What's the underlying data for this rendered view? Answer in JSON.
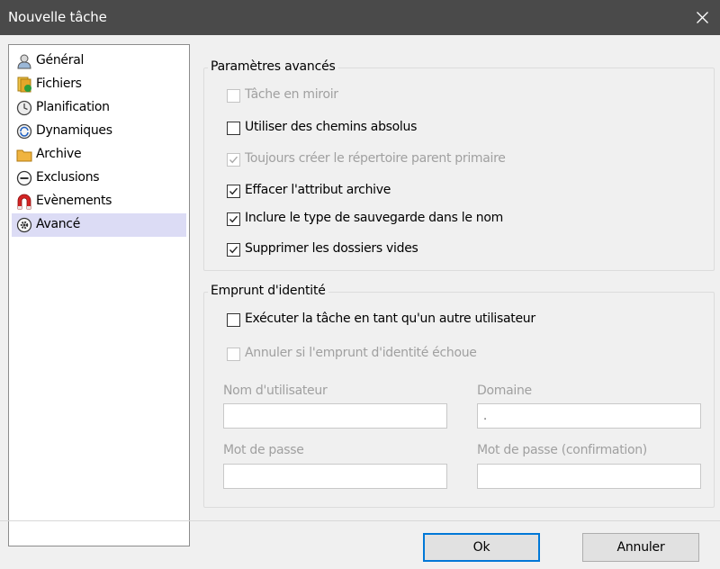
{
  "window": {
    "title": "Nouvelle tâche"
  },
  "nav": {
    "items": [
      {
        "label": "Général",
        "icon": "user-icon"
      },
      {
        "label": "Fichiers",
        "icon": "files-icon"
      },
      {
        "label": "Planification",
        "icon": "clock-icon"
      },
      {
        "label": "Dynamiques",
        "icon": "dynamics-icon"
      },
      {
        "label": "Archive",
        "icon": "archive-icon"
      },
      {
        "label": "Exclusions",
        "icon": "exclusions-icon"
      },
      {
        "label": "Evènements",
        "icon": "magnet-icon"
      },
      {
        "label": "Avancé",
        "icon": "gear-icon",
        "selected": true
      }
    ]
  },
  "advanced": {
    "title": "Paramètres avancés",
    "options": [
      {
        "label": "Tâche en miroir",
        "checked": false,
        "enabled": false
      },
      {
        "label": "Utiliser des chemins absolus",
        "checked": false,
        "enabled": true
      },
      {
        "label": "Toujours créer le répertoire parent primaire",
        "checked": true,
        "enabled": false
      },
      {
        "label": "Effacer l'attribut archive",
        "checked": true,
        "enabled": true
      },
      {
        "label": "Inclure le type de sauvegarde dans le nom",
        "checked": true,
        "enabled": true
      },
      {
        "label": "Supprimer les dossiers vides",
        "checked": true,
        "enabled": true
      }
    ]
  },
  "impersonation": {
    "title": "Emprunt d'identité",
    "options": [
      {
        "label": "Exécuter la tâche en tant qu'un autre utilisateur",
        "checked": false,
        "enabled": true
      },
      {
        "label": "Annuler si l'emprunt d'identité échoue",
        "checked": false,
        "enabled": false
      }
    ],
    "username_label": "Nom d'utilisateur",
    "username_value": "",
    "domain_label": "Domaine",
    "domain_value": ".",
    "password_label": "Mot de passe",
    "password_value": "",
    "password_confirm_label": "Mot de passe (confirmation)",
    "password_confirm_value": ""
  },
  "buttons": {
    "ok": "Ok",
    "cancel": "Annuler"
  },
  "colors": {
    "titlebar": "#4a4a4a",
    "selection": "#dcdcf5",
    "focus": "#0078d7"
  }
}
